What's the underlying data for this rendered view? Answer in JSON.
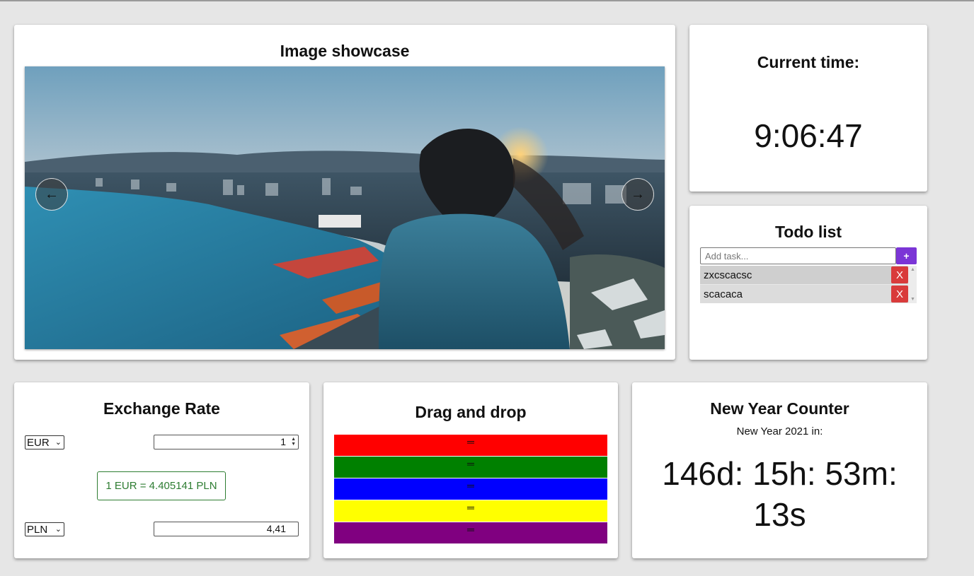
{
  "showcase": {
    "title": "Image showcase",
    "prev_icon": "arrow-left-icon",
    "next_icon": "arrow-right-icon",
    "prev_glyph": "←",
    "next_glyph": "→"
  },
  "clock": {
    "title": "Current time:",
    "time": "9:06:47"
  },
  "todo": {
    "title": "Todo list",
    "placeholder": "Add task...",
    "add_label": "+",
    "items": [
      {
        "text": "zxcscacsc",
        "delete_label": "X"
      },
      {
        "text": "scacaca",
        "delete_label": "X"
      }
    ]
  },
  "exchange": {
    "title": "Exchange Rate",
    "from_currency": "EUR",
    "from_amount": "1",
    "rate_text": "1 EUR = 4.405141 PLN",
    "to_currency": "PLN",
    "to_amount": "4,41"
  },
  "dnd": {
    "title": "Drag and drop",
    "handle_glyph": "═",
    "items": [
      {
        "color": "#ff0000"
      },
      {
        "color": "#008000"
      },
      {
        "color": "#0000ff"
      },
      {
        "color": "#ffff00"
      },
      {
        "color": "#800080"
      }
    ]
  },
  "newyear": {
    "title": "New Year Counter",
    "subtitle": "New Year 2021 in:",
    "countdown": "146d: 15h: 53m: 13s"
  },
  "colors": {
    "page_bg": "#e6e6e6",
    "accent_purple": "#7b35d6",
    "delete_red": "#d93b3b",
    "rate_green": "#2e7d32"
  }
}
